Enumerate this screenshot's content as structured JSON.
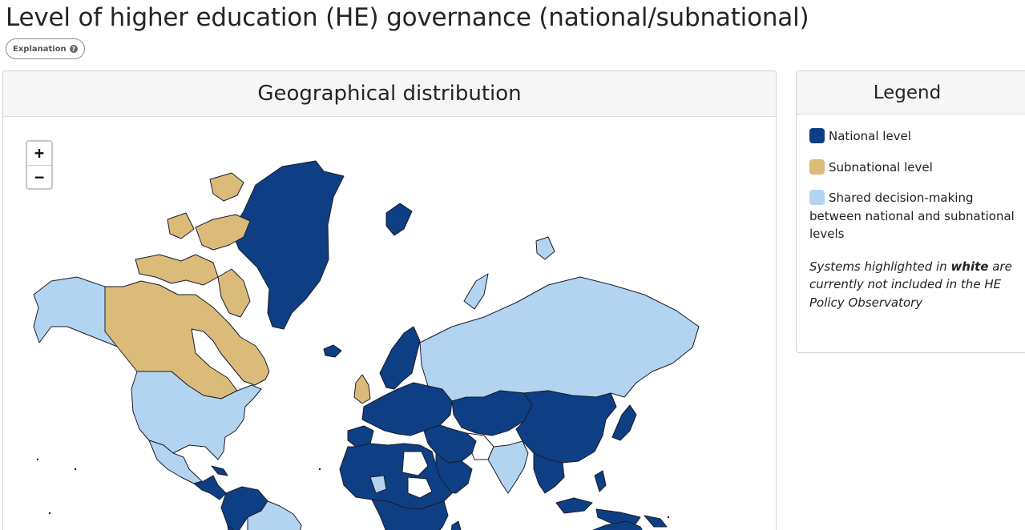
{
  "page": {
    "title": "Level of higher education (HE) governance (national/subnational)",
    "explanation_label": "Explanation"
  },
  "map_card": {
    "title": "Geographical distribution",
    "zoom_in": "+",
    "zoom_out": "−"
  },
  "legend": {
    "title": "Legend",
    "items": [
      {
        "label": "National level",
        "color": "#0e3f84"
      },
      {
        "label": "Subnational level",
        "color": "#dbbb7a"
      },
      {
        "label": "Shared decision-making between national and subnational levels",
        "color": "#b3d4f0"
      }
    ],
    "note_prefix": "Systems highlighted in ",
    "note_emph": "white",
    "note_suffix": " are currently not included in the HE Policy Observatory"
  },
  "icons": {
    "explanation": "question-circle-icon"
  }
}
